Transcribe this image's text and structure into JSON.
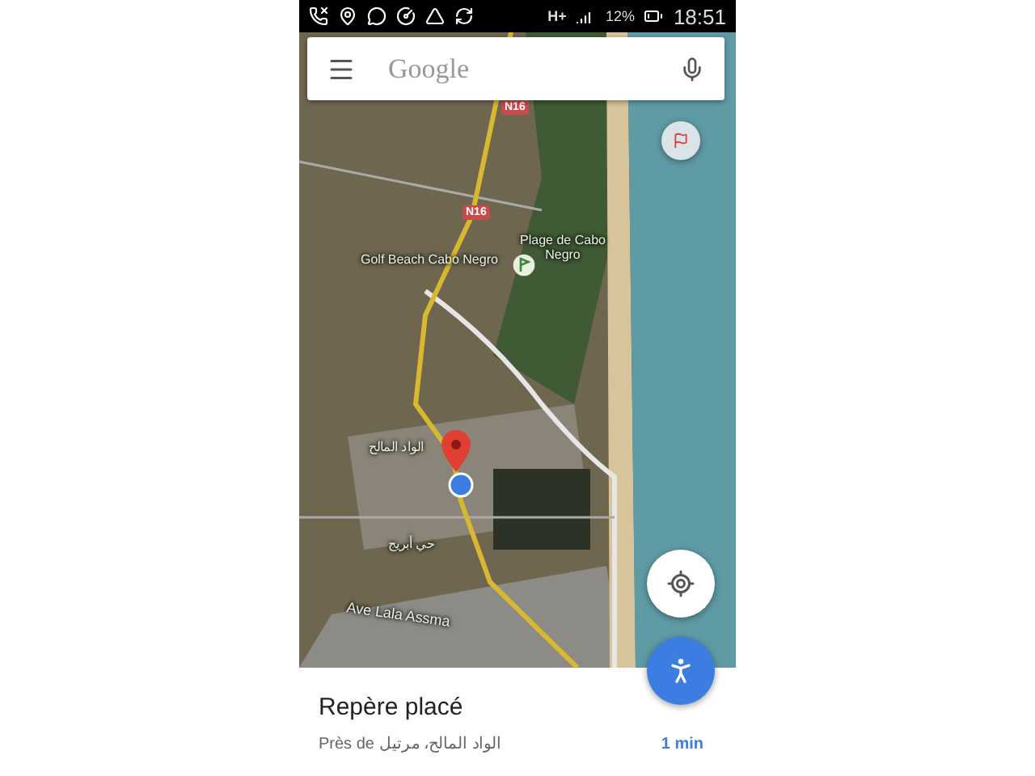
{
  "status_bar": {
    "network": "H+",
    "battery": "12%",
    "time": "18:51"
  },
  "search": {
    "placeholder": "Google"
  },
  "map": {
    "labels": [
      {
        "kind": "shield",
        "text": "N16"
      },
      {
        "kind": "shield",
        "text": "N16"
      },
      {
        "kind": "place",
        "text": "Golf Beach Cabo Negro"
      },
      {
        "kind": "place",
        "text": "Plage de Cabo Negro"
      },
      {
        "kind": "place",
        "text": "الواد المالح"
      },
      {
        "kind": "place",
        "text": "حي أبريج"
      },
      {
        "kind": "street",
        "text": "Ave Lala Assma"
      }
    ]
  },
  "place_sheet": {
    "title": "Repère placé",
    "subtitle": "Près de الواد المالح، مرتيل",
    "travel_time": "1 min"
  }
}
